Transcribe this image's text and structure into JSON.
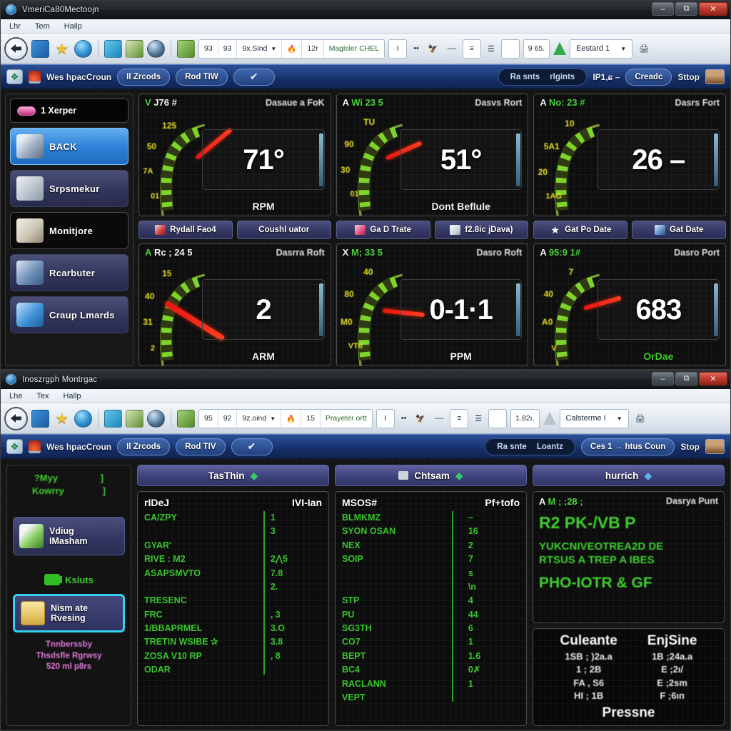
{
  "window_top": {
    "title": "VmeriCa80Mectoojn",
    "icon": "app-globe-icon",
    "controls": {
      "minimize": "–",
      "maximize": "⧉",
      "close": "✕"
    },
    "menu": [
      "Lhr",
      "Tem",
      "Hailp"
    ],
    "toolbar": {
      "back_icon": "back-arrow-icon",
      "icons": [
        "chart-blue-icon",
        "star-icon",
        "globe-icon",
        "chart-cyan-icon",
        "grid-green-icon",
        "ball-icon",
        "green-box-icon"
      ],
      "group1": [
        "93",
        "93",
        "9x.Sind"
      ],
      "flame_icon": "flame-icon",
      "value1": "12r",
      "label1": "Magisler CHEL",
      "text_tool": "I",
      "dots": "••",
      "bird_icon": "bird-red-icon",
      "dash": "––",
      "lines_icon": "lines-icon",
      "stack_icon": "stack-icon",
      "plate_icon": "plate-icon",
      "value2": "9 65.",
      "triangle_icon": "green-triangle-icon",
      "select_value": "Eestard 1",
      "printer_icon": "printer-icon"
    },
    "appbar": {
      "leaf_icon": "leaf-icon",
      "lock_icon": "lock-icon",
      "label": "Wes hpacCroun",
      "pill1": "Il Zrcods",
      "pill2": "Rod TIW",
      "chevron": "✔",
      "dark_left": "Ra snts",
      "dark_right": "rlgints",
      "ip_text": "IP1,ɕ –",
      "btn_create": "Creadc",
      "btn_stop": "Sttop",
      "image_icon": "image-thumb-icon"
    },
    "sidebar": {
      "header": {
        "badge": "badge-pill",
        "label": "1 Xerper"
      },
      "items": [
        {
          "label": "BACK",
          "icon": "wrench-icon",
          "state": "active"
        },
        {
          "label": "Srpsmekur",
          "icon": "paper-icon",
          "state": "normal"
        },
        {
          "label": "Monitjore",
          "icon": "box-icon",
          "state": "dark"
        },
        {
          "label": "Rcarbuter",
          "icon": "computer-icon",
          "state": "normal"
        },
        {
          "label": "Craup Lmards",
          "icon": "drum-icon",
          "state": "normal"
        }
      ]
    },
    "gauges_row1": [
      {
        "head_left_pre": "V",
        "head_left": "J76 #",
        "head_right": "Dasaue a FoK",
        "value": "71°",
        "hot": "7",
        "label": "RPM",
        "ticks": [
          "125",
          "50",
          "7A",
          "01"
        ],
        "needle_angle": -38
      },
      {
        "head_left_pre": "A",
        "head_left": "Wi 23 5",
        "head_right": "Dasvs Rort",
        "value": "51°",
        "hot": "5",
        "label": "Dont Beflule",
        "ticks": [
          "TU",
          "90",
          "30",
          "01"
        ],
        "needle_angle": -22
      },
      {
        "head_left_pre": "A",
        "head_left": "No: 23 #",
        "head_right": "Dasrs Fort",
        "value": "26 –",
        "hot": "2",
        "label": "",
        "ticks": [
          "10",
          "5A1",
          "20",
          "1AG"
        ],
        "needle_angle": -10
      }
    ],
    "button_strip": [
      {
        "label": "Rydall Fao4",
        "icon": "red-doc-icon"
      },
      {
        "label": "Coushl uator",
        "icon": "none"
      },
      {
        "label": "Ga D Trate",
        "icon": "pink-gift-icon"
      },
      {
        "label": "f2.8ic jDava)",
        "icon": "white-card-icon"
      },
      {
        "label": "Gat Po Date",
        "icon": "star-icon"
      },
      {
        "label": "Gat Date",
        "icon": "blue-book-icon"
      }
    ],
    "gauges_row2": [
      {
        "head_left_pre": "A",
        "head_left": "Rc ; 24 5",
        "head_right": "Dasrra Roft",
        "value": "2",
        "hot": "",
        "label": "ARM",
        "ticks": [
          "15",
          "40",
          "31",
          "2"
        ],
        "needle_angle": 30
      },
      {
        "head_left_pre": "X",
        "head_left": "M; 33 5",
        "head_right": "Dasro Roft",
        "value": "0-1·1",
        "hot": "0",
        "label": "PPM",
        "ticks": [
          "40",
          "80",
          "M0",
          "VT6"
        ],
        "needle_angle": 4
      },
      {
        "head_left_pre": "A",
        "head_left": "95:9 1#",
        "head_right": "Dasro Port",
        "value": "683",
        "hot": "6",
        "label": "OrDae",
        "ticks": [
          "7",
          "40",
          "A0",
          "V"
        ],
        "needle_angle": -16
      }
    ]
  },
  "window_bottom": {
    "title": "Inoszrgph Montrgac",
    "icon": "app-globe-icon",
    "controls": {
      "minimize": "–",
      "maximize": "⧉",
      "close": "✕"
    },
    "menu": [
      "Lhe",
      "Tex",
      "Hallp"
    ],
    "toolbar": {
      "back_icon": "back-arrow-icon",
      "icons": [
        "chart-blue-icon",
        "star-icon",
        "globe-icon",
        "chart-cyan-icon",
        "grid-green-icon",
        "ball-icon",
        "green-box-icon"
      ],
      "group1": [
        "95",
        "92",
        "9z.oind"
      ],
      "flame_icon": "flame-icon",
      "value1": "15",
      "label1": "Prayeter ortt",
      "text_tool": "I",
      "dots": "••",
      "bird_icon": "bird-red-icon",
      "dash": "––",
      "lines_icon": "lines-icon",
      "stack_icon": "stack-icon",
      "plate_icon": "plate-icon",
      "value2": "1.82ı.",
      "triangle_icon": "grey-triangle-icon",
      "select_value": "Calsterme I",
      "printer_icon": "printer-icon"
    },
    "appbar": {
      "leaf_icon": "leaf-icon",
      "lock_icon": "lock-icon",
      "label": "Wes hpacCroun",
      "pill1": "Il Zrcods",
      "pill2": "Rod TIV",
      "chevron": "✔",
      "dark_left": "Ra snte",
      "dark_right": "Loantz",
      "ip_text": "Ces 1  →  htus Coun",
      "btn_create": "",
      "btn_stop": "Stop",
      "image_icon": "image-thumb-icon"
    },
    "left_panel": {
      "stat1_key": "?Myy",
      "stat1_val": "]",
      "stat2_key": "Kowrry",
      "stat2_val": "]",
      "button1": {
        "line1": "Vdiug",
        "line2": "IMasham",
        "icon": "spray-icon"
      },
      "green_label": "Ksiuts",
      "button2": {
        "line1": "Nism ate",
        "line2": "Rvesing",
        "icon": "folder-icon",
        "selected": true
      },
      "note": "Tnnberssby\nThsdsfle Rgrwsy\n520 ml p8rs"
    },
    "panel1": {
      "title": "TasThin",
      "chevron_color": "#39c96a",
      "col_key": "rIDeJ",
      "col_val": "IVI-Ian",
      "rows": [
        {
          "k": "CA/ZPY",
          "v": "1"
        },
        {
          "k": "",
          "v": "3"
        },
        {
          "k": "GYAR'",
          "v": ""
        },
        {
          "k": "RIVE : M2",
          "v": "2⋀5"
        },
        {
          "k": "ASAPSMVTO",
          "v": "7.8"
        },
        {
          "k": "",
          "v": "2."
        },
        {
          "k": "TRESENC",
          "v": ""
        },
        {
          "k": "FRC",
          "v": ", 3"
        },
        {
          "k": "",
          "v": ""
        },
        {
          "k": "1/BBAPRMEL",
          "v": "3.O"
        },
        {
          "k": "TRETIN WSIBE ✰",
          "v": "3.8"
        },
        {
          "k": "",
          "v": ""
        },
        {
          "k": "ZOSA V10 RP",
          "v": ", 8"
        },
        {
          "k": "ODAR",
          "v": ""
        }
      ]
    },
    "panel2": {
      "title": "Chtsam",
      "chevron_color": "#39c96a",
      "header_icon": "small-icon",
      "col_key": "MSOS#",
      "col_val": "Pf+tofo",
      "rows": [
        {
          "k": "BLMKMZ",
          "v": "–"
        },
        {
          "k": "SYON OSAN",
          "v": "16"
        },
        {
          "k": "",
          "v": ""
        },
        {
          "k": "NEX",
          "v": "2"
        },
        {
          "k": "SOIP",
          "v": "7"
        },
        {
          "k": "",
          "v": "s"
        },
        {
          "k": "",
          "v": ""
        },
        {
          "k": "",
          "v": "\\n"
        },
        {
          "k": "STP",
          "v": "4"
        },
        {
          "k": "PU",
          "v": "44"
        },
        {
          "k": "SG3TH",
          "v": "6"
        },
        {
          "k": "CO7",
          "v": "1"
        },
        {
          "k": "BEPT",
          "v": "1.6"
        },
        {
          "k": "",
          "v": ""
        },
        {
          "k": "BC4",
          "v": "0✗"
        },
        {
          "k": "RACLANN",
          "v": "1"
        },
        {
          "k": "VEPT",
          "v": ""
        }
      ]
    },
    "panel3": {
      "title": "hurrich",
      "chevron_color": "#5fb4e8",
      "head_left_pre": "A",
      "head_left": "M ; ;28 ;",
      "head_right": "Dasrya Punt",
      "line1": "R2 PK-/VB P",
      "line2": "YUKCNIVEOTREA2D DE",
      "line3": "RTSUS A TREP A IBES",
      "line4": "PHO-IOTR & GF"
    },
    "panel4": {
      "col1_title": "Culeante",
      "col1_rows": [
        "1SB ; )2a.a",
        "1 ; 2B",
        "FA , S6",
        "HI ; 1B"
      ],
      "col2_title": "EnjSine",
      "col2_rows": [
        "1B ;24a.a",
        "E ;2ı/",
        "E ;2ѕm",
        "F ;6ıп"
      ],
      "footer": "Pressne"
    }
  }
}
